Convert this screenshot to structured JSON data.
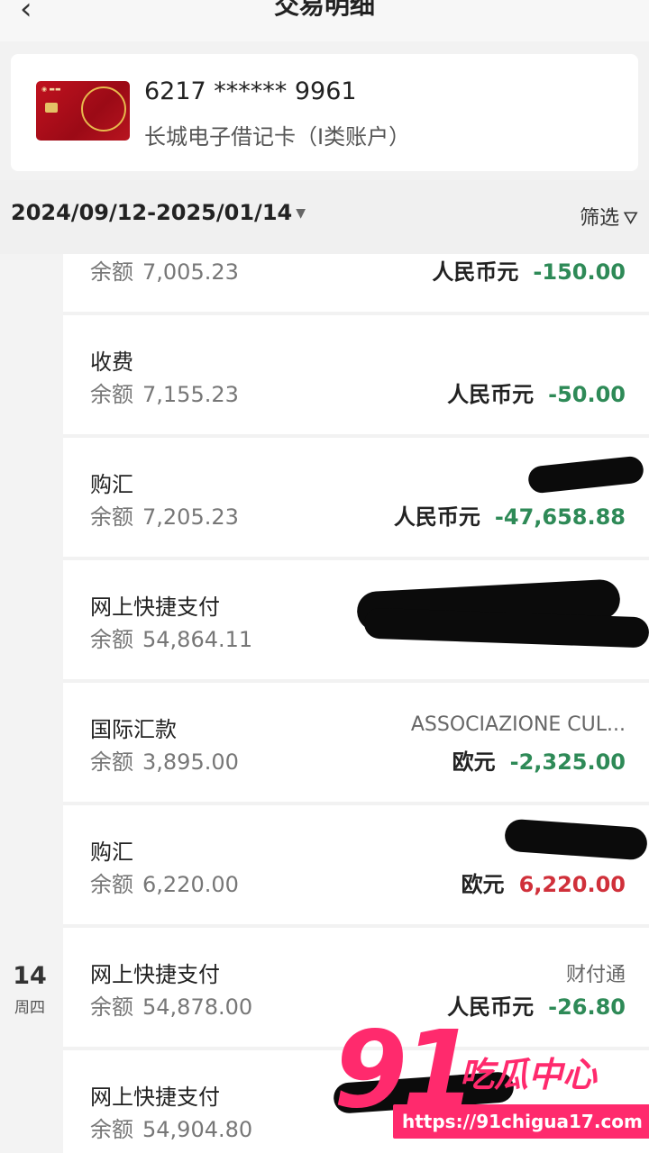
{
  "header": {
    "title": "交易明细",
    "back_icon": "chevron-left-icon"
  },
  "card": {
    "number": "6217 ****** 9961",
    "name": "长城电子借记卡（I类账户）"
  },
  "filter": {
    "date_range": "2024/09/12-2025/01/14",
    "filter_label": "筛选"
  },
  "balance_label": "余额",
  "transactions": [
    {
      "type": "",
      "balance": "7,005.23",
      "currency": "人民币元",
      "amount": "-150.00",
      "sign": "negative"
    },
    {
      "type": "收费",
      "balance": "7,155.23",
      "currency": "人民币元",
      "amount": "-50.00",
      "sign": "negative"
    },
    {
      "type": "购汇",
      "balance": "7,205.23",
      "currency": "人民币元",
      "amount": "-47,658.88",
      "sign": "negative"
    },
    {
      "type": "网上快捷支付",
      "balance": "54,864.11",
      "currency": "",
      "amount": "",
      "sign": "redacted"
    },
    {
      "type": "国际汇款",
      "balance": "3,895.00",
      "counterparty": "ASSOCIAZIONE CUL...",
      "currency": "欧元",
      "amount": "-2,325.00",
      "sign": "negative"
    },
    {
      "type": "购汇",
      "balance": "6,220.00",
      "currency": "欧元",
      "amount": "6,220.00",
      "sign": "positive"
    },
    {
      "type": "网上快捷支付",
      "balance": "54,878.00",
      "counterparty": "财付通",
      "currency": "人民币元",
      "amount": "-26.80",
      "sign": "negative"
    },
    {
      "type": "网上快捷支付",
      "balance": "54,904.80",
      "currency": "",
      "amount": "",
      "sign": "redacted"
    }
  ],
  "date_marker": {
    "day": "14",
    "weekday": "周四"
  },
  "watermark": {
    "brand_number": "91",
    "brand_text": "吃瓜中心",
    "url": "https://91chigua17.com"
  },
  "colors": {
    "negative": "#2e8a57",
    "positive": "#d0303a",
    "watermark": "#ff2a6d"
  }
}
